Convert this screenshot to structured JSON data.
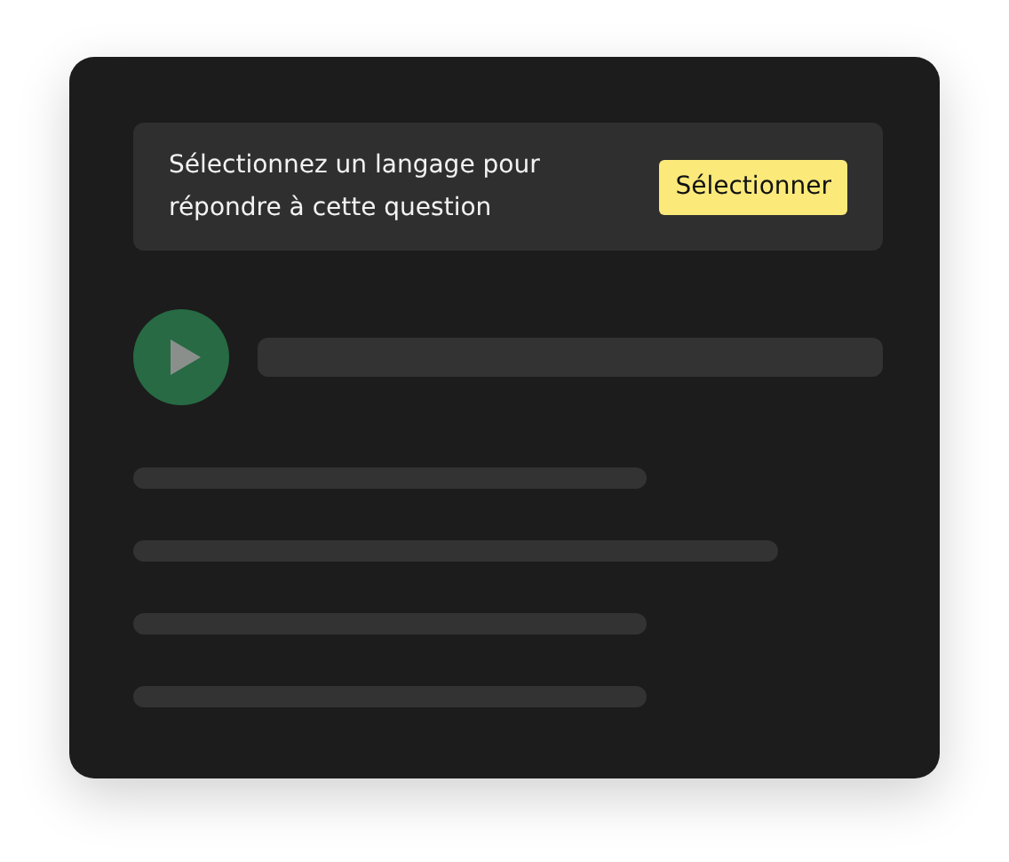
{
  "prompt": {
    "text": "Sélectionnez un langage pour répondre à cette question",
    "button": "Sélectionner"
  }
}
